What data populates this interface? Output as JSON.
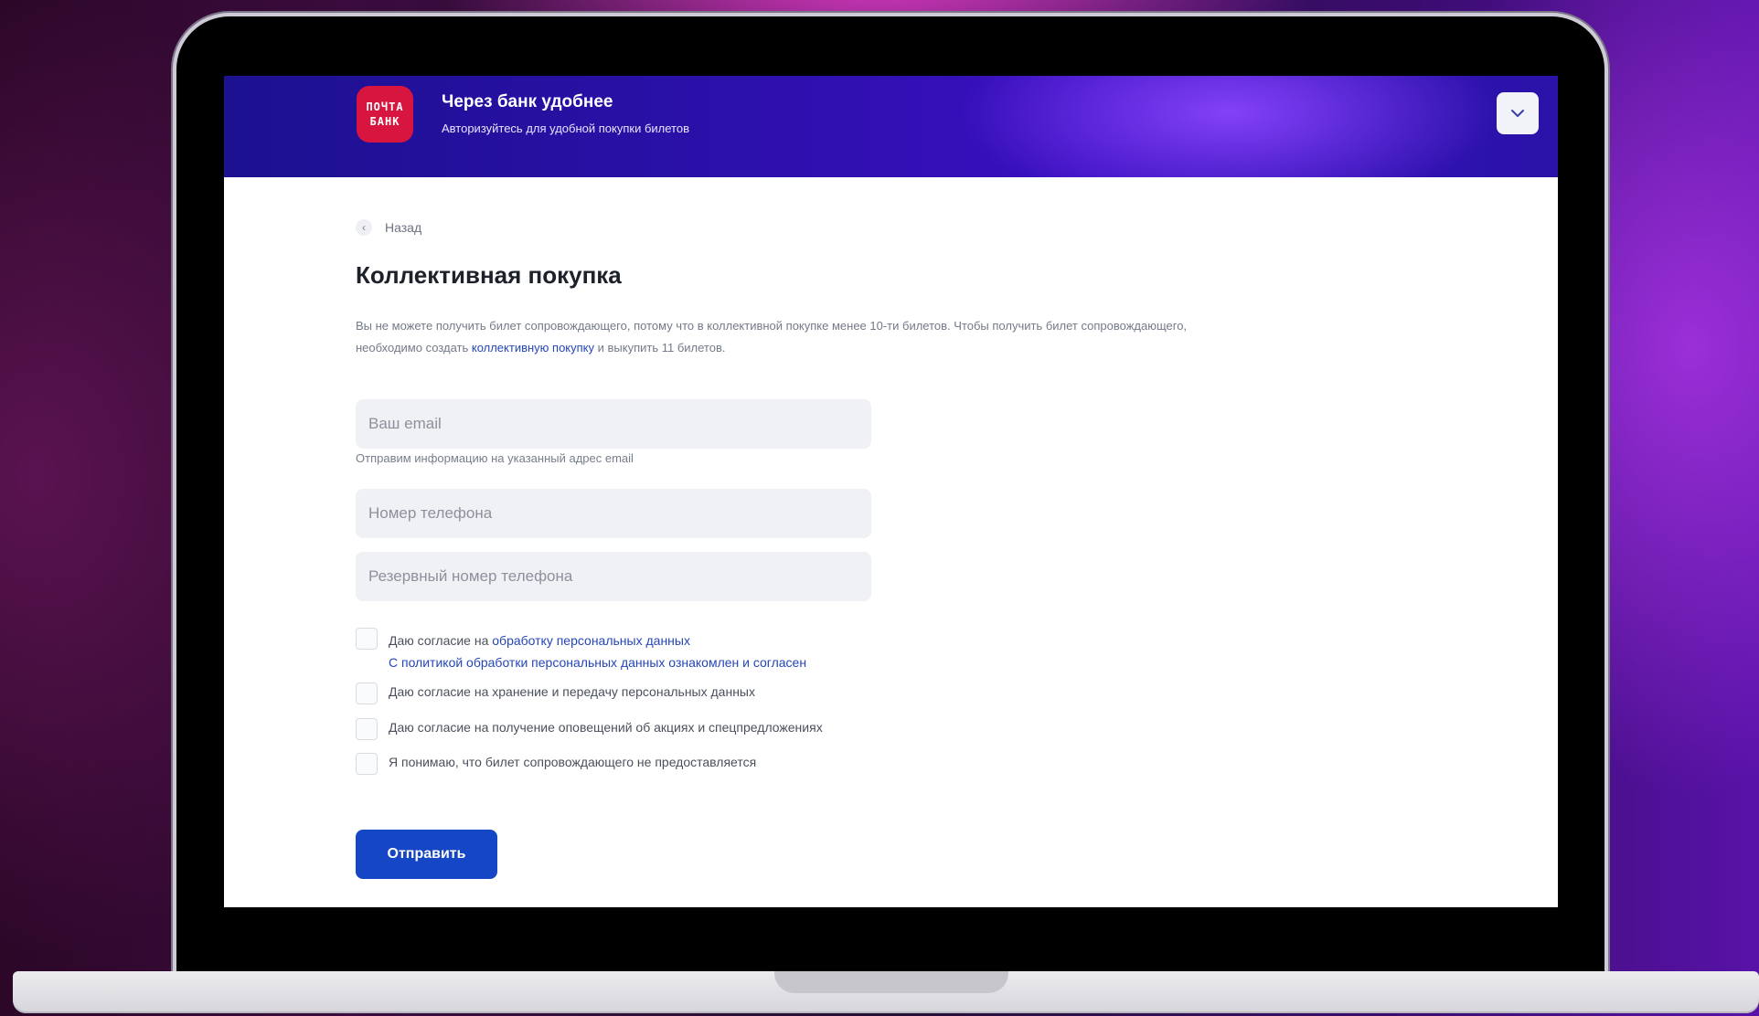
{
  "banner": {
    "logo_line1": "ПОЧТА",
    "logo_line2": "БАНК",
    "title": "Через банк удобнее",
    "subtitle": "Авторизуйтесь для удобной покупки билетов",
    "toggle_icon": "chevron-down-icon"
  },
  "nav": {
    "back_label": "Назад"
  },
  "page": {
    "title": "Коллективная покупка",
    "desc_part1": "Вы не можете получить билет сопровождающего, потому что в коллективной покупке менее 10-ти билетов. Чтобы получить билет сопровождающего, необходимо создать ",
    "desc_link": "коллективную покупку",
    "desc_part2": " и выкупить 11 билетов."
  },
  "form": {
    "email_placeholder": "Ваш email",
    "email_hint": "Отправим информацию на указанный адрес email",
    "phone_placeholder": "Номер телефона",
    "reserve_phone_placeholder": "Резервный номер телефона",
    "consents": [
      {
        "pre": "Даю согласие на ",
        "link": "обработку персональных данных",
        "line2": "С политикой обработки персональных данных ознакомлен и согласен"
      },
      {
        "text": "Даю согласие на хранение и передачу персональных данных"
      },
      {
        "text": "Даю согласие на получение оповещений об акциях и спецпредложениях"
      },
      {
        "text": "Я понимаю, что билет сопровождающего не предоставляется"
      }
    ],
    "submit_label": "Отправить"
  },
  "colors": {
    "accent": "#1446c6",
    "brand_red": "#d8153e",
    "banner": "#2a10a8"
  }
}
